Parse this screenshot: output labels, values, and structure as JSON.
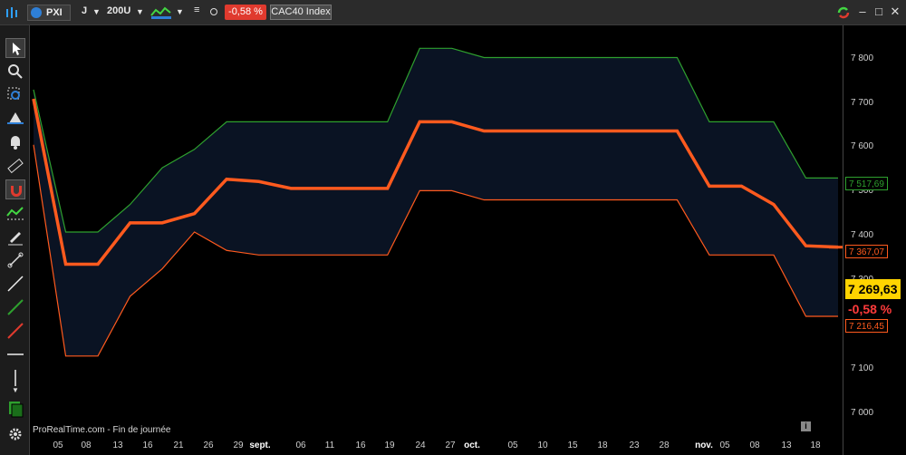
{
  "toolbar": {
    "symbol": "PXI",
    "period": "J",
    "units": "200U",
    "change_badge": "-0,58 %",
    "instrument": "CAC40 Index",
    "chart_type_icon": "candlestick-icon",
    "indicator_icon": "indicator-wave-icon"
  },
  "side_tools": [
    {
      "name": "pointer-tool-icon"
    },
    {
      "name": "zoom-tool-icon"
    },
    {
      "name": "zoom-area-tool-icon"
    },
    {
      "name": "alert-tool-icon"
    },
    {
      "name": "bell-tool-icon"
    },
    {
      "name": "ruler-tool-icon"
    },
    {
      "name": "magnet-tool-icon"
    },
    {
      "name": "trend-tool-icon"
    },
    {
      "name": "pencil-tool-icon"
    },
    {
      "name": "segment-tool-icon"
    },
    {
      "name": "line-white-tool-icon"
    },
    {
      "name": "line-green-tool-icon"
    },
    {
      "name": "line-red-tool-icon"
    },
    {
      "name": "horizontal-line-tool-icon"
    },
    {
      "name": "vertical-line-tool-icon"
    }
  ],
  "price_axis": {
    "ticks": [
      "7 800",
      "7 700",
      "7 600",
      "7 500",
      "7 400",
      "7 300",
      "7 100",
      "7 000"
    ],
    "labels": {
      "upper": "7 517,69",
      "middle": "7 367,07",
      "last": "7 269,63",
      "change": "-0,58 %",
      "lower": "7 216,45"
    },
    "colors": {
      "upper": "#2ea02e",
      "middle": "#ff5a1e",
      "last_bg": "#ffd400",
      "lower": "#ff5a1e"
    }
  },
  "date_axis": {
    "ticks": [
      "05",
      "08",
      "13",
      "16",
      "21",
      "26",
      "29",
      "sept.",
      "06",
      "11",
      "16",
      "19",
      "24",
      "27",
      "oct.",
      "05",
      "10",
      "15",
      "18",
      "23",
      "28",
      "nov.",
      "05",
      "08",
      "13",
      "18"
    ]
  },
  "footer": {
    "brand": "ProRealTime.com - Fin de journée",
    "info": "i"
  },
  "chart_data": {
    "type": "line",
    "instrument": "CAC40 Index",
    "ylim": [
      6950,
      7850
    ],
    "x": [
      "05",
      "08",
      "13",
      "16",
      "21",
      "26",
      "29",
      "sept.",
      "06",
      "11",
      "16",
      "19",
      "24",
      "27",
      "oct.",
      "05",
      "10",
      "15",
      "18",
      "23",
      "28",
      "nov.",
      "05",
      "08",
      "13",
      "18"
    ],
    "series": [
      {
        "values": [
          7690,
          7330,
          7330,
          7420,
          7420,
          7440,
          7515,
          7510,
          7495,
          7495,
          7495,
          7495,
          7640,
          7640,
          7620,
          7620,
          7620,
          7620,
          7620,
          7620,
          7620,
          7500,
          7500,
          7460,
          7370,
          7367.07
        ]
      },
      {
        "values": [
          7710,
          7400,
          7400,
          7460,
          7540,
          7580,
          7640,
          7640,
          7640,
          7640,
          7640,
          7640,
          7800,
          7800,
          7780,
          7780,
          7780,
          7780,
          7780,
          7780,
          7780,
          7640,
          7640,
          7640,
          7517.69,
          7517.69
        ]
      },
      {
        "values": [
          7590,
          7130,
          7130,
          7260,
          7320,
          7400,
          7360,
          7350,
          7350,
          7350,
          7350,
          7350,
          7490,
          7490,
          7470,
          7470,
          7470,
          7470,
          7470,
          7470,
          7470,
          7350,
          7350,
          7350,
          7216.45,
          7216.45
        ]
      }
    ],
    "last_price": "7 269,63",
    "change": "-0,58 %"
  }
}
